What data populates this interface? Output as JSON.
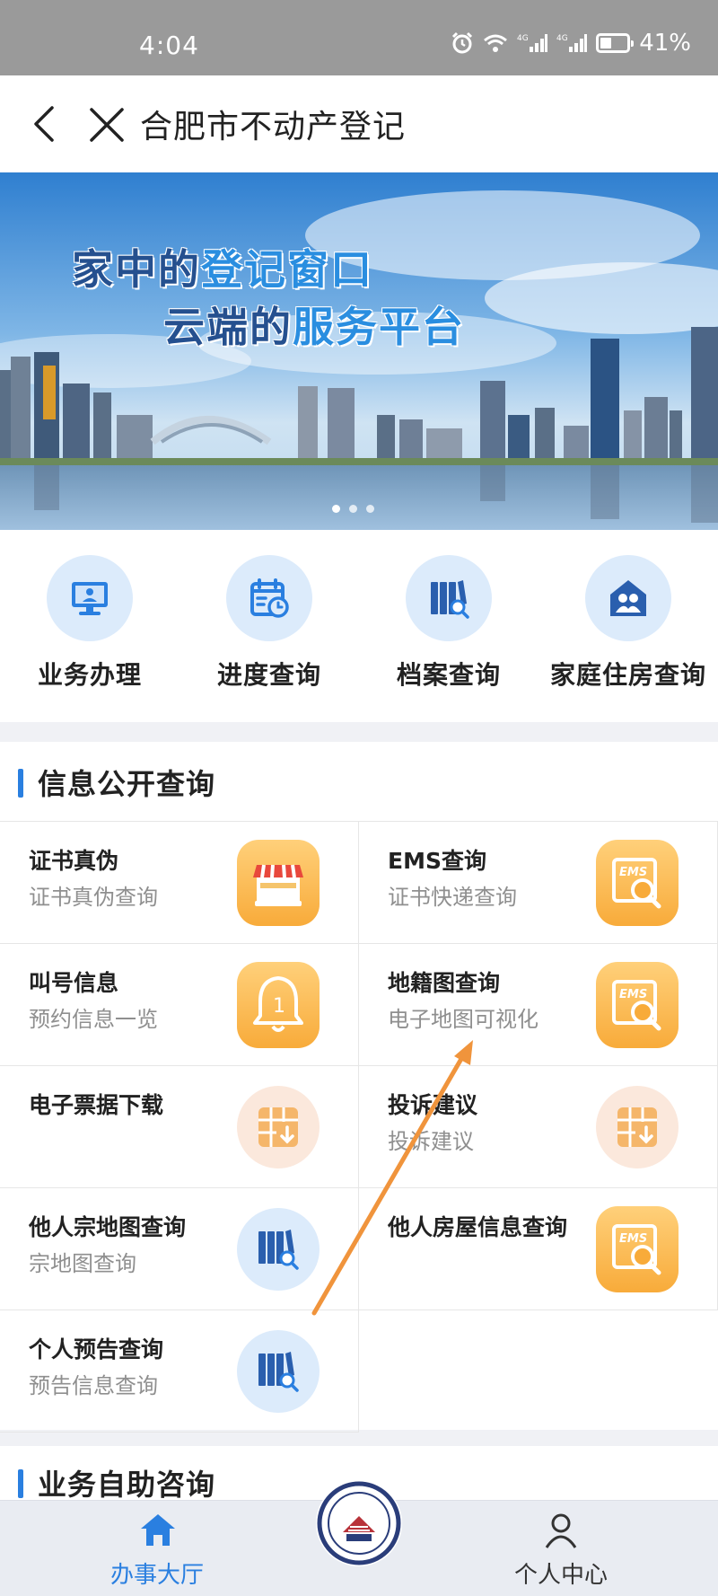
{
  "status_bar": {
    "time": "4:04",
    "battery": "41%"
  },
  "nav": {
    "title": "合肥市不动产登记"
  },
  "banner": {
    "line1_a": "家中的",
    "line1_b": "登记窗口",
    "line2_a": "云端的",
    "line2_b": "服务平台"
  },
  "quick_nav": [
    {
      "label": "业务办理",
      "icon": "monitor-service-icon"
    },
    {
      "label": "进度查询",
      "icon": "calendar-clock-icon"
    },
    {
      "label": "档案查询",
      "icon": "archive-search-icon"
    },
    {
      "label": "家庭住房查询",
      "icon": "family-house-icon"
    }
  ],
  "info_section": {
    "title": "信息公开查询",
    "items": [
      {
        "title": "证书真伪",
        "subtitle": "证书真伪查询",
        "icon": "storefront-icon"
      },
      {
        "title": "EMS查询",
        "subtitle": "证书快递查询",
        "icon": "ems-search-icon"
      },
      {
        "title": "叫号信息",
        "subtitle": "预约信息一览",
        "icon": "bell-number-icon"
      },
      {
        "title": "地籍图查询",
        "subtitle": "电子地图可视化",
        "icon": "ems-search-icon"
      },
      {
        "title": "电子票据下载",
        "subtitle": "",
        "icon": "grid-download-icon"
      },
      {
        "title": "投诉建议",
        "subtitle": "投诉建议",
        "icon": "grid-download-icon"
      },
      {
        "title": "他人宗地图查询",
        "subtitle": "宗地图查询",
        "icon": "archive-search-icon"
      },
      {
        "title": "他人房屋信息查询",
        "subtitle": "",
        "icon": "ems-search-icon"
      },
      {
        "title": "个人预告查询",
        "subtitle": "预告信息查询",
        "icon": "archive-search-icon"
      }
    ],
    "ems_text": "EMS",
    "bell_number": "1"
  },
  "self_help_section": {
    "title": "业务自助咨询"
  },
  "tab_bar": {
    "home_label": "办事大厅",
    "me_label": "个人中心"
  },
  "colors": {
    "accent": "#2a7fe0",
    "orange_icon": "#f8ab3a",
    "annotation_arrow": "#f0943c"
  }
}
